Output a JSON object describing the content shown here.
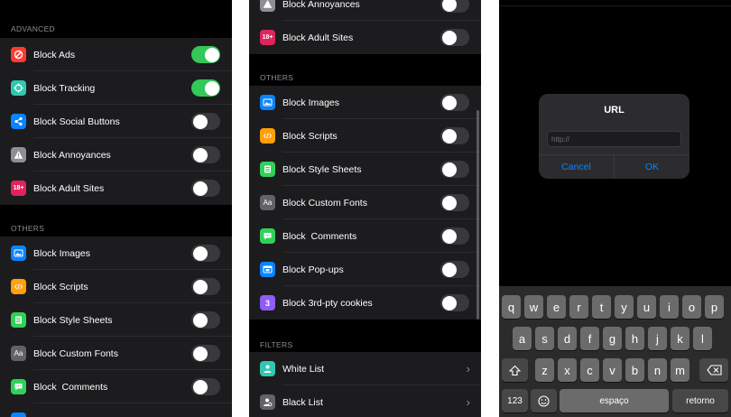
{
  "panel1": {
    "section_advanced": "ADVANCED",
    "section_others": "OTHERS",
    "rows": [
      {
        "label": "Block Ads",
        "on": true
      },
      {
        "label": "Block Tracking",
        "on": true
      },
      {
        "label": "Block Social Buttons",
        "on": false
      },
      {
        "label": "Block Annoyances",
        "on": false
      },
      {
        "label": "Block Adult Sites",
        "on": false
      },
      {
        "label": "Block Images",
        "on": false
      },
      {
        "label": "Block Scripts",
        "on": false
      },
      {
        "label": "Block Style Sheets",
        "on": false
      },
      {
        "label": "Block Custom Fonts",
        "on": false
      },
      {
        "label": "Block  Comments",
        "on": false
      }
    ]
  },
  "panel2": {
    "section_others": "OTHERS",
    "section_filters": "FILTERS",
    "rows": [
      {
        "label": "Block Annoyances",
        "on": false
      },
      {
        "label": "Block Adult Sites",
        "on": false
      },
      {
        "label": "Block Images",
        "on": false
      },
      {
        "label": "Block Scripts",
        "on": false
      },
      {
        "label": "Block Style Sheets",
        "on": false
      },
      {
        "label": "Block Custom Fonts",
        "on": false
      },
      {
        "label": "Block  Comments",
        "on": false
      },
      {
        "label": "Block Pop-ups",
        "on": false
      },
      {
        "label": "Block 3rd-pty cookies",
        "on": false
      }
    ],
    "filters": [
      {
        "label": "White List"
      },
      {
        "label": "Black List"
      }
    ]
  },
  "icons": {
    "adult_badge": "18+",
    "fonts_badge": "Aa",
    "third_party_badge": "3",
    "colors": {
      "ads": "#ff3b30",
      "tracking": "#30c8b0",
      "social": "#0a84ff",
      "annoyances": "#8e8e93",
      "adult": "#e0245e",
      "images": "#0a84ff",
      "scripts": "#ff9f0a",
      "stylesheets": "#30d158",
      "fonts": "#636366",
      "comments": "#30d158",
      "popups": "#0a84ff",
      "cookies": "#8e5cf7",
      "whitelist": "#30c8b0",
      "blacklist": "#636366"
    }
  },
  "dialog": {
    "title": "URL",
    "placeholder": "http://",
    "cancel": "Cancel",
    "ok": "OK"
  },
  "keyboard": {
    "row1": [
      "q",
      "w",
      "e",
      "r",
      "t",
      "y",
      "u",
      "i",
      "o",
      "p"
    ],
    "row2": [
      "a",
      "s",
      "d",
      "f",
      "g",
      "h",
      "j",
      "k",
      "l"
    ],
    "row3": [
      "z",
      "x",
      "c",
      "v",
      "b",
      "n",
      "m"
    ],
    "numbers": "123",
    "space": "espaço",
    "return": "retorno"
  }
}
